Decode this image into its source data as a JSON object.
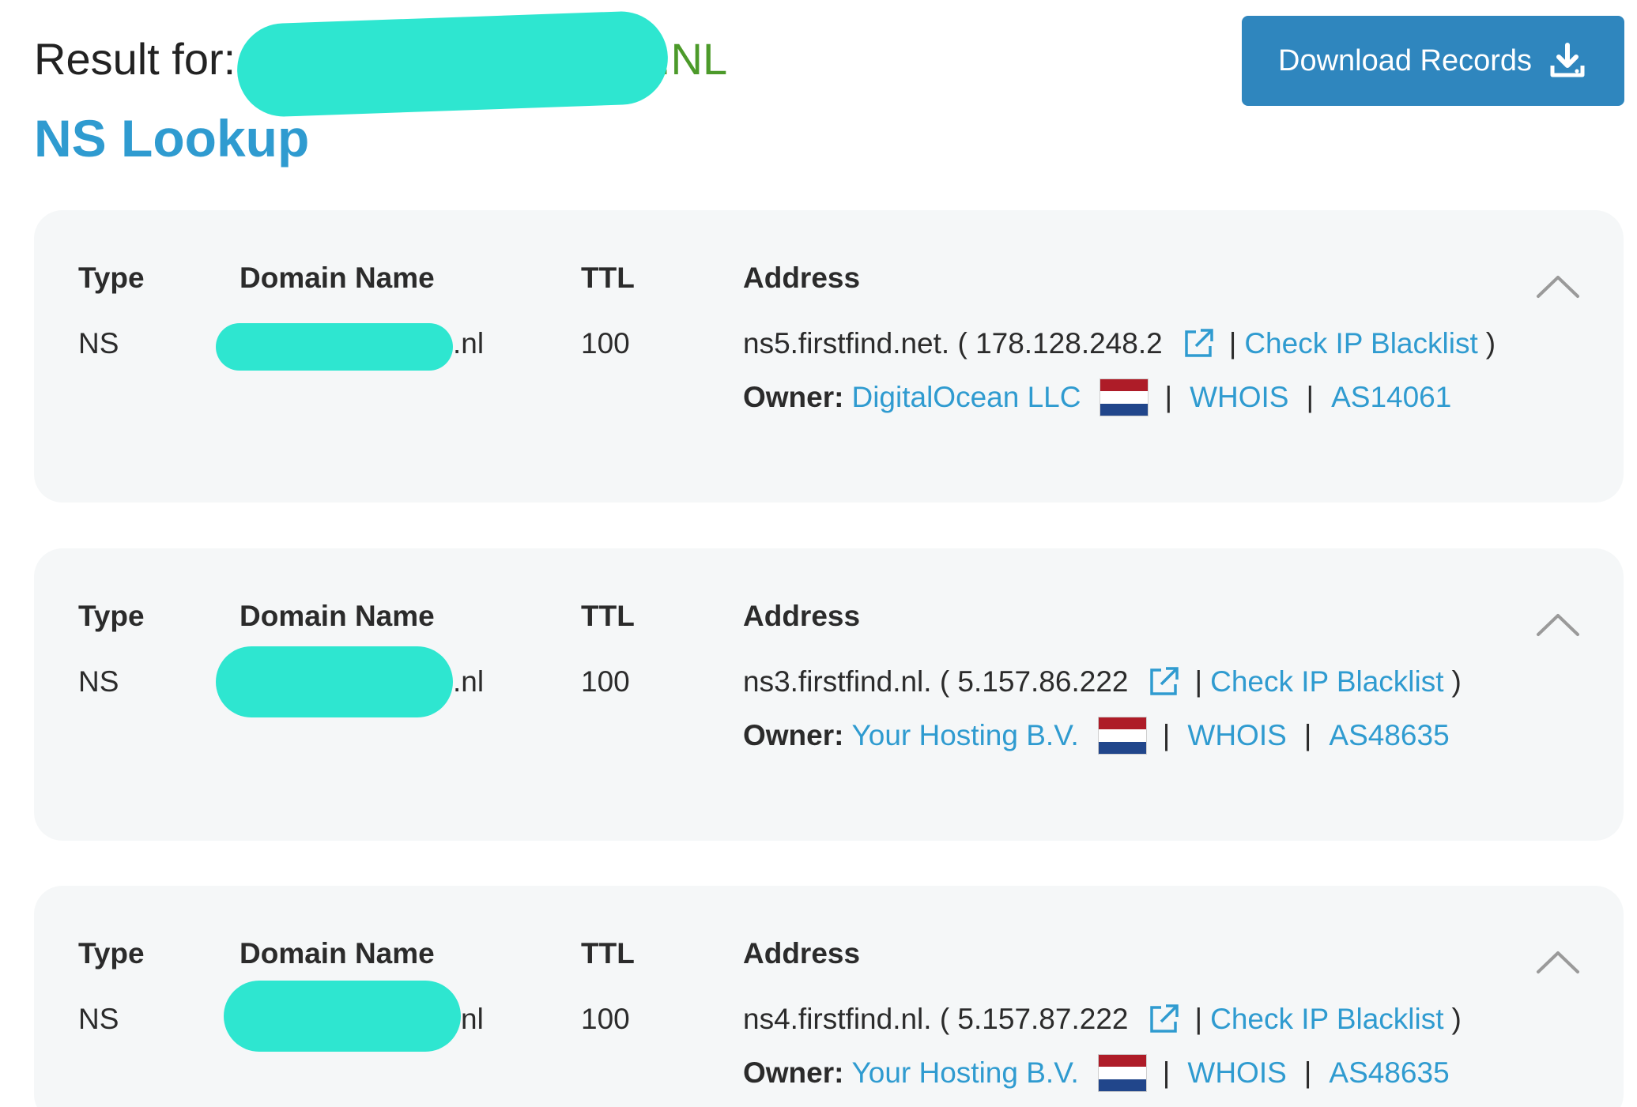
{
  "header": {
    "result_label": "Result for:",
    "result_tld": ".NL",
    "title": "NS Lookup",
    "download_label": "Download Records"
  },
  "table_headers": {
    "type": "Type",
    "domain": "Domain Name",
    "ttl": "TTL",
    "address": "Address"
  },
  "colors": {
    "accent": "#2f9bd0",
    "button": "#2f86be",
    "redaction": "#2ee6d0",
    "tld_green": "#4c9a2a",
    "card_bg": "#f5f7f8"
  },
  "records": [
    {
      "type": "NS",
      "domain_suffix": ".nl",
      "ttl": "100",
      "host": "ns5.firstfind.net. ( 178.128.248.2",
      "check_prefix": "|",
      "check_label": "Check IP Blacklist",
      "check_suffix": ")",
      "owner_label": "Owner:",
      "owner": "DigitalOcean LLC",
      "sep1": "|",
      "whois": "WHOIS",
      "sep2": "|",
      "asn": "AS14061"
    },
    {
      "type": "NS",
      "domain_suffix": ".nl",
      "ttl": "100",
      "host": "ns3.firstfind.nl. ( 5.157.86.222",
      "check_prefix": "|",
      "check_label": "Check IP Blacklist",
      "check_suffix": ")",
      "owner_label": "Owner:",
      "owner": "Your Hosting B.V.",
      "sep1": "|",
      "whois": "WHOIS",
      "sep2": "|",
      "asn": "AS48635"
    },
    {
      "type": "NS",
      "domain_suffix": "nl",
      "ttl": "100",
      "host": "ns4.firstfind.nl. ( 5.157.87.222",
      "check_prefix": "|",
      "check_label": "Check IP Blacklist",
      "check_suffix": ")",
      "owner_label": "Owner:",
      "owner": "Your Hosting B.V.",
      "sep1": "|",
      "whois": "WHOIS",
      "sep2": "|",
      "asn": "AS48635"
    }
  ]
}
